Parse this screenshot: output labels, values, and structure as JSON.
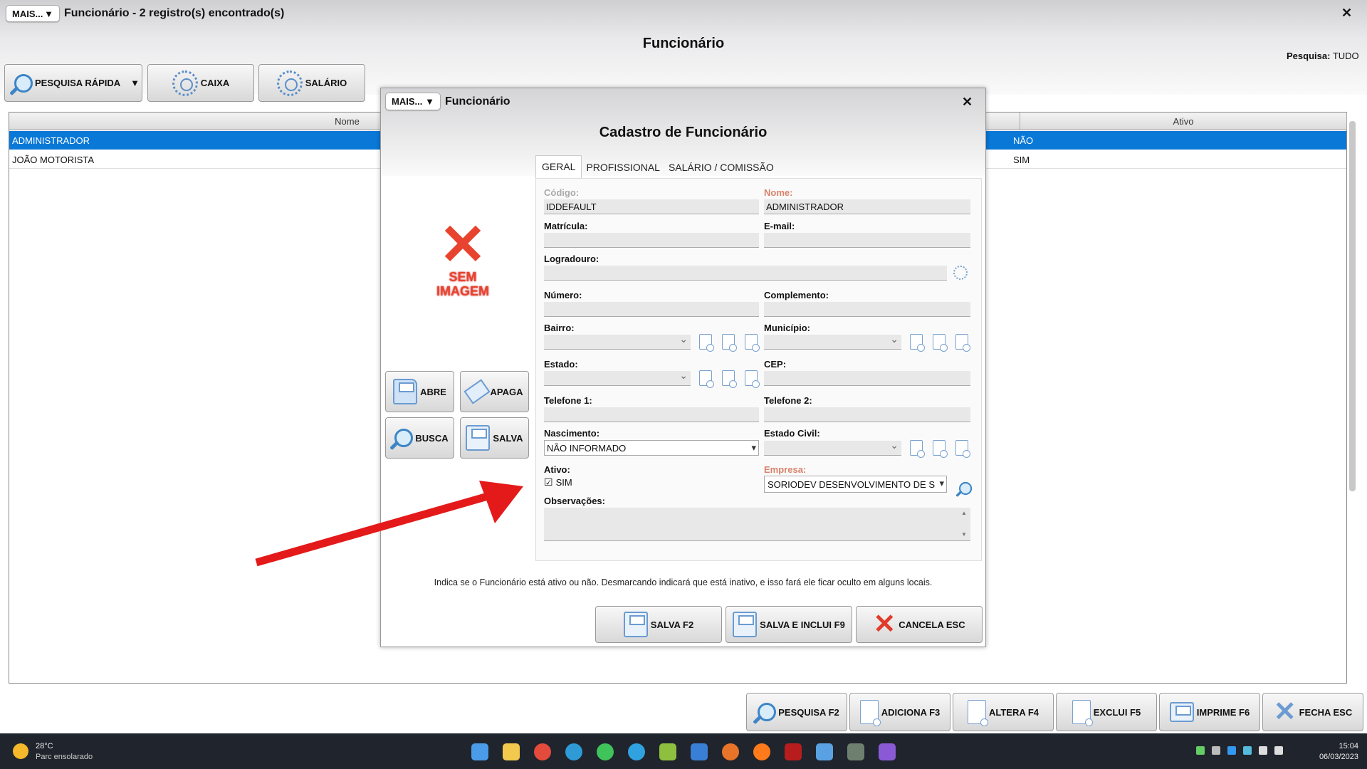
{
  "window": {
    "mais": "MAIS...",
    "arrow": "▼",
    "title": "Funcionário - 2 registro(s) encontrado(s)",
    "heading": "Funcionário",
    "close": "✕",
    "search_label": "Pesquisa:",
    "search_value": "TUDO"
  },
  "toolbar": {
    "pesquisa": "PESQUISA RÁPIDA",
    "caixa": "CAIXA",
    "salario": "SALÁRIO"
  },
  "grid": {
    "col_nome": "Nome",
    "col_ativo": "Ativo",
    "rows": [
      {
        "nome": "ADMINISTRADOR",
        "ativo": "NÃO"
      },
      {
        "nome": "JOÃO MOTORISTA",
        "ativo": "SIM"
      }
    ]
  },
  "dialog": {
    "mais": "MAIS...",
    "title": "Funcionário",
    "close": "✕",
    "heading": "Cadastro de Funcionário",
    "tabs": [
      "GERAL",
      "PROFISSIONAL",
      "SALÁRIO / COMISSÃO"
    ],
    "no_image": "SEM IMAGEM",
    "side": {
      "abre": "ABRE",
      "apaga": "APAGA",
      "busca": "BUSCA",
      "salva": "SALVA"
    },
    "fields": {
      "codigo_l": "Código:",
      "codigo": "IDDEFAULT",
      "nome_l": "Nome:",
      "nome": "ADMINISTRADOR",
      "matricula_l": "Matrícula:",
      "email_l": "E-mail:",
      "logradouro_l": "Logradouro:",
      "numero_l": "Número:",
      "complemento_l": "Complemento:",
      "bairro_l": "Bairro:",
      "municipio_l": "Município:",
      "estado_l": "Estado:",
      "cep_l": "CEP:",
      "tel1_l": "Telefone 1:",
      "tel2_l": "Telefone 2:",
      "nasc_l": "Nascimento:",
      "nasc": "NÃO INFORMADO",
      "civil_l": "Estado Civil:",
      "ativo_l": "Ativo:",
      "ativo_check": "☑",
      "ativo": "SIM",
      "empresa_l": "Empresa:",
      "empresa": "SORIODEV DESENVOLVIMENTO DE S",
      "obs_l": "Observações:"
    },
    "hint": "Indica se o Funcionário está ativo ou não. Desmarcando indicará que está inativo, e isso fará ele ficar oculto em alguns locais.",
    "footer": {
      "salva": "SALVA F2",
      "salva_inclui": "SALVA E INCLUI F9",
      "cancela": "CANCELA ESC"
    }
  },
  "bottom": {
    "pesquisa": "PESQUISA F2",
    "adiciona": "ADICIONA F3",
    "altera": "ALTERA F4",
    "exclui": "EXCLUI F5",
    "imprime": "IMPRIME F6",
    "fecha": "FECHA ESC"
  },
  "taskbar": {
    "temp": "28°C",
    "weather": "Parc ensolarado",
    "time": "15:04",
    "date": "06/03/2023"
  },
  "colors": {
    "selection": "#0a78d7",
    "arrow": "#e41a1a"
  }
}
